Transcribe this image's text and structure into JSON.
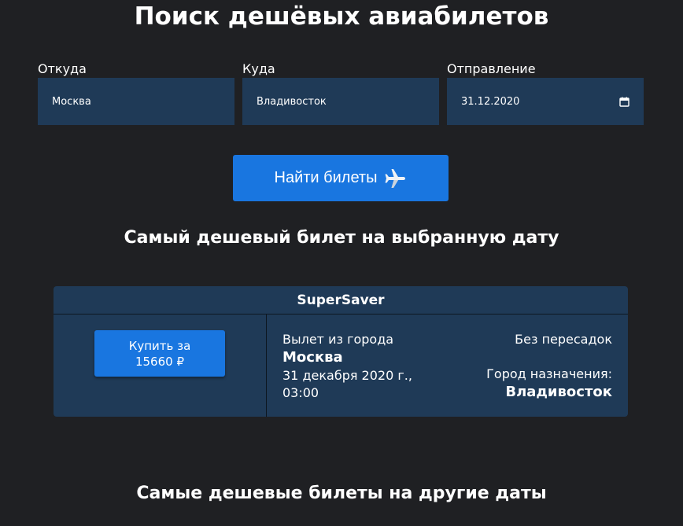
{
  "header": {
    "title": "Поиск дешёвых авиабилетов"
  },
  "form": {
    "from_label": "Откуда",
    "from_value": "Москва",
    "to_label": "Куда",
    "to_value": "Владивосток",
    "date_label": "Отправление",
    "date_value": "31.12.2020",
    "date_icon": "calendar-icon",
    "search_label": "Найти билеты",
    "search_icon": "airplane-icon"
  },
  "cheapest": {
    "heading": "Самый дешевый билет на выбранную дату",
    "agent": "SuperSaver",
    "buy_line1": "Купить за",
    "buy_line2": "15660 ₽",
    "depart_label": "Вылет из города",
    "depart_city": "Москва",
    "depart_datetime_line1": "31 декабря 2020 г.,",
    "depart_datetime_line2": "03:00",
    "transfers": "Без пересадок",
    "dest_label": "Город назначения:",
    "dest_city": "Владивосток"
  },
  "other": {
    "heading": "Самые дешевые билеты на другие даты"
  },
  "colors": {
    "background": "#1f2023",
    "field_bg": "#1f3a57",
    "accent": "#1976e0"
  }
}
